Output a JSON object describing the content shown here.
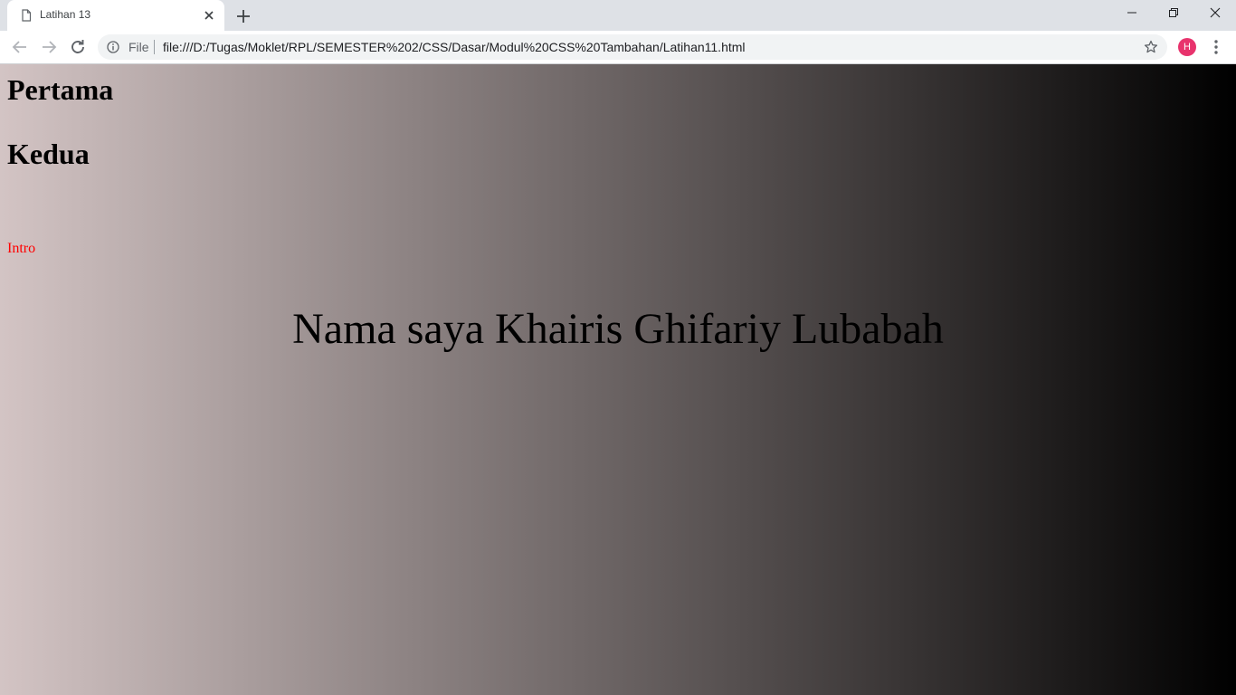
{
  "browser": {
    "tab": {
      "title": "Latihan 13"
    },
    "address_bar": {
      "scheme_chip": "File",
      "url": "file:///D:/Tugas/Moklet/RPL/SEMESTER%202/CSS/Dasar/Modul%20CSS%20Tambahan/Latihan11.html"
    },
    "profile": {
      "initial": "H",
      "color": "#e8336d"
    },
    "icons": {
      "tab_favicon": "page-icon",
      "tab_close": "close-icon",
      "new_tab": "plus-icon",
      "back": "arrow-left-icon",
      "forward": "arrow-right-icon",
      "reload": "reload-icon",
      "site_info": "info-icon",
      "bookmark": "star-icon",
      "menu": "kebab-menu-icon",
      "minimize": "minimize-icon",
      "maximize": "restore-icon",
      "close_window": "close-icon"
    }
  },
  "page": {
    "heading_first": "Pertama",
    "heading_second": "Kedua",
    "intro": "Intro",
    "intro_color": "#ff0000",
    "name_line": "Nama saya Khairis Ghifariy Lubabah",
    "background_gradient": {
      "direction": "to right",
      "from": "#d3c4c4",
      "to": "#000000"
    }
  }
}
